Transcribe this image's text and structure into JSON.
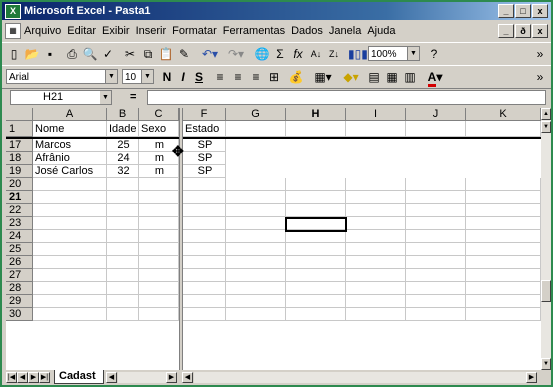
{
  "window": {
    "title": "Microsoft Excel - Pasta1",
    "minimize": "_",
    "maximize": "□",
    "close": "x"
  },
  "menubar": {
    "items": [
      "Arquivo",
      "Editar",
      "Exibir",
      "Inserir",
      "Formatar",
      "Ferramentas",
      "Dados",
      "Janela",
      "Ajuda"
    ],
    "doc_minimize": "_",
    "doc_restore": "ð",
    "doc_close": "x"
  },
  "toolbar": {
    "zoom": "100%",
    "more": "»"
  },
  "formatbar": {
    "font": "Arial",
    "size": "10",
    "bold": "N",
    "italic": "I",
    "underline": "S",
    "more": "»"
  },
  "formula": {
    "namebox": "H21",
    "eq": "=",
    "content": ""
  },
  "columns": {
    "left": [
      "A",
      "B",
      "C"
    ],
    "right": [
      "F",
      "G",
      "H",
      "I",
      "J",
      "K"
    ]
  },
  "rows": {
    "header": {
      "num": "1",
      "cells": [
        "Nome",
        "Idade",
        "Sexo",
        "Estado"
      ]
    },
    "data": [
      {
        "num": "17",
        "cells": [
          "Marcos",
          "25",
          "m",
          "SP"
        ]
      },
      {
        "num": "18",
        "cells": [
          "Afrânio",
          "24",
          "m",
          "SP"
        ]
      },
      {
        "num": "19",
        "cells": [
          "José Carlos",
          "32",
          "m",
          "SP"
        ]
      }
    ],
    "empty": [
      "20",
      "21",
      "22",
      "23",
      "24",
      "25",
      "26",
      "27",
      "28",
      "29",
      "30"
    ]
  },
  "active_cell": "H21",
  "sheet": {
    "tab": "Cadast"
  }
}
